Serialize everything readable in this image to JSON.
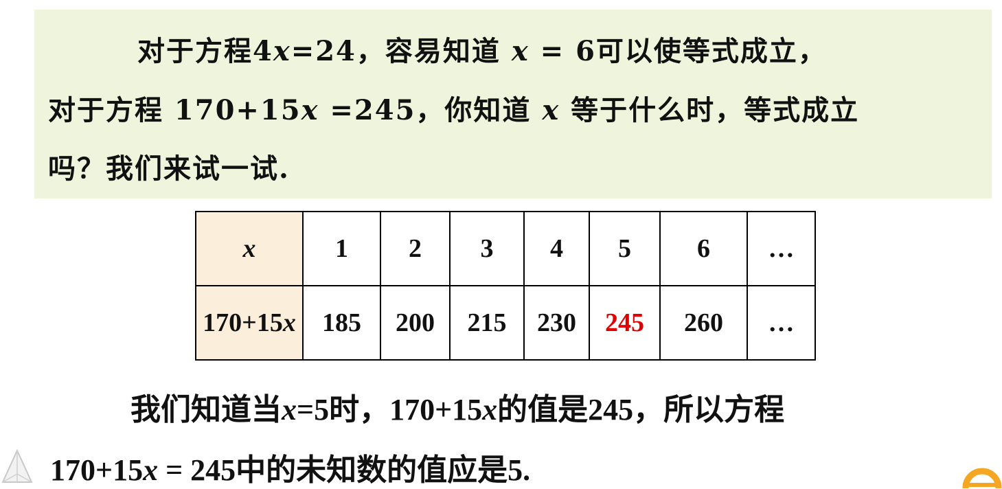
{
  "intro": {
    "line1_a": "对于方程4",
    "line1_x": "x",
    "line1_b": "=24，容易知道",
    "line1_x2": "x",
    "line1_c": "= 6可以使等式成立，",
    "line2_a": "对于方程 170+15",
    "line2_x": "x",
    "line2_b": " =245，你知道",
    "line2_x2": "x",
    "line2_c": " 等于什么时，等式成立",
    "line3": "吗？我们来试一试."
  },
  "table": {
    "header_label": "x",
    "x_values": [
      "1",
      "2",
      "3",
      "4",
      "5",
      "6",
      "…"
    ],
    "row_label_a": "170+15",
    "row_label_x": "x",
    "results": [
      "185",
      "200",
      "215",
      "230",
      "245",
      "260",
      "…"
    ]
  },
  "conclusion": {
    "line1_a": "我们知道当",
    "line1_x": "x",
    "line1_b": "=5时，170+15",
    "line1_x2": "x",
    "line1_c": "的值是245，所以方程",
    "line2_a": "170+15",
    "line2_x": "x",
    "line2_b": " = 245中的未知数的值应是5."
  },
  "colors": {
    "intro_background": "#eff5dc",
    "header_cell_background": "#fbefdc",
    "highlight": "#e00000",
    "ring": "#f5a623"
  },
  "icons": [
    "pyramid-icon",
    "ring-icon"
  ]
}
